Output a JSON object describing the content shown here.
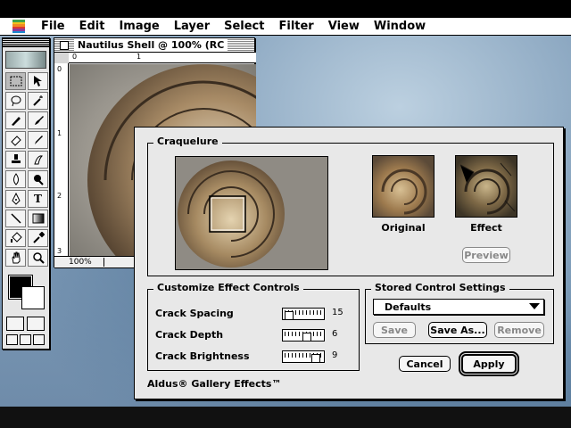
{
  "menubar": {
    "items": [
      "File",
      "Edit",
      "Image",
      "Layer",
      "Select",
      "Filter",
      "View",
      "Window"
    ]
  },
  "tools": {
    "type_glyph": "T"
  },
  "document": {
    "title": "Nautilus Shell @ 100% (RC",
    "zoom": "100%",
    "ruler_top": [
      "0",
      "1"
    ],
    "ruler_left": [
      "0",
      "1",
      "2",
      "3"
    ]
  },
  "dialog": {
    "title": "Craquelure",
    "thumbs": {
      "original_label": "Original",
      "effect_label": "Effect"
    },
    "preview_button": "Preview",
    "customize": {
      "title": "Customize Effect Controls",
      "controls": [
        {
          "label": "Crack Spacing",
          "value": "15",
          "level": 0.05
        },
        {
          "label": "Crack Depth",
          "value": "6",
          "level": 0.6
        },
        {
          "label": "Crack Brightness",
          "value": "9",
          "level": 0.9
        }
      ]
    },
    "stored": {
      "title": "Stored Control Settings",
      "selected": "Defaults",
      "save": "Save",
      "save_as": "Save As...",
      "remove": "Remove"
    },
    "cancel": "Cancel",
    "apply": "Apply",
    "brand": "Aldus® Gallery Effects™"
  },
  "colors": {
    "foreground": "#000000",
    "background": "#ffffff"
  }
}
